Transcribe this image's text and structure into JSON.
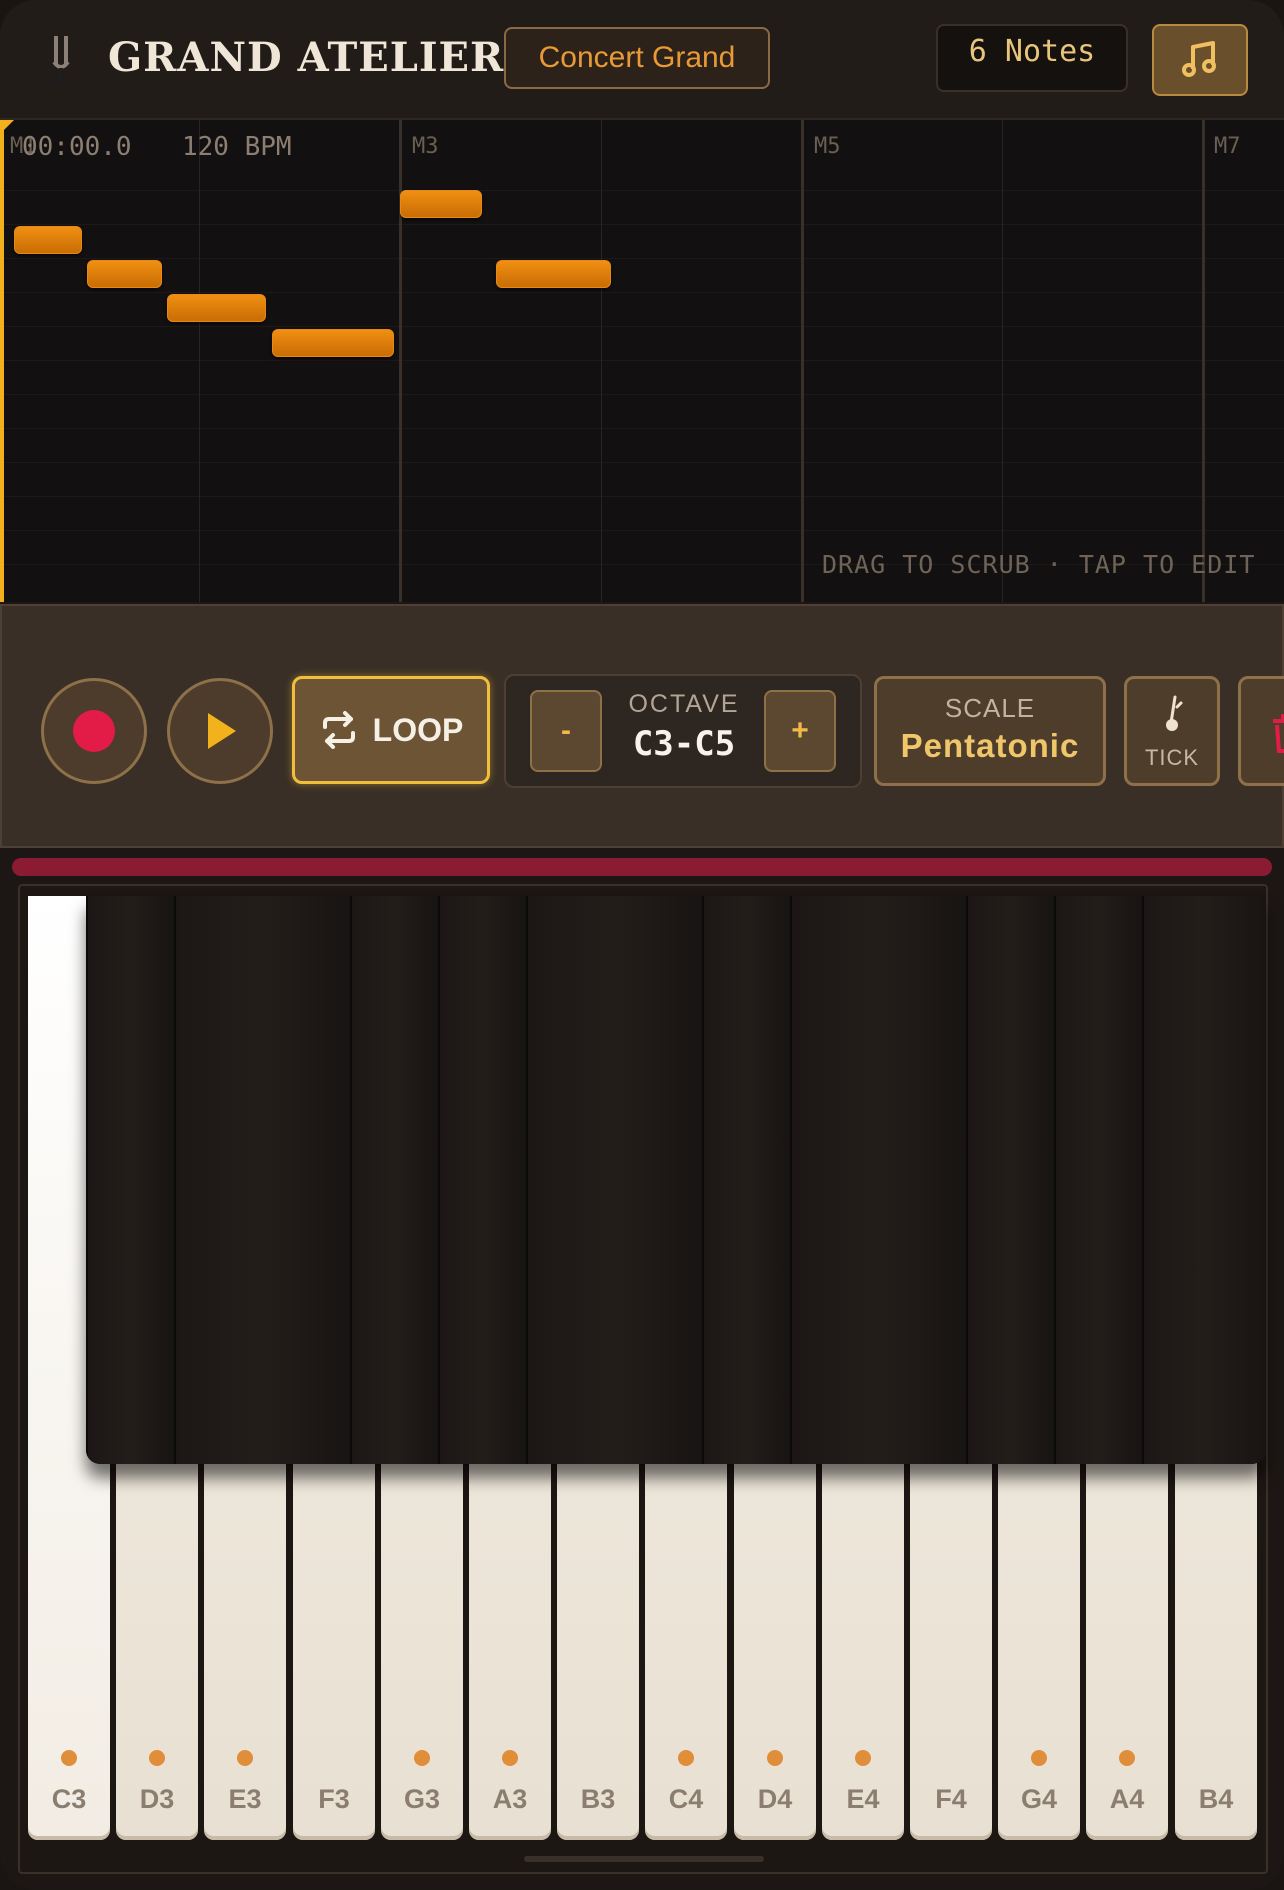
{
  "header": {
    "title": "GRAND ATELIER",
    "instrument": "Concert Grand",
    "notes_count": "6 Notes"
  },
  "timeline": {
    "time": "00:00.0",
    "bpm": "120 BPM",
    "measures": [
      "M1",
      "M3",
      "M5",
      "M7"
    ],
    "hint": "DRAG TO SCRUB · TAP TO EDIT",
    "playhead_color": "#f2b01c",
    "note_color": "#e8820c"
  },
  "controls": {
    "loop_label": "LOOP",
    "loop_active": true,
    "octave_title": "OCTAVE",
    "octave_range": "C3-C5",
    "octave_minus": "-",
    "octave_plus": "+",
    "scale_title": "SCALE",
    "scale_value": "Pentatonic",
    "tick_label": "TICK",
    "record_color": "#e31b47",
    "accent": "#f2bf3c"
  },
  "velocity": {
    "color": "#8b1a33"
  },
  "keyboard": {
    "white_keys": [
      {
        "label": "C3",
        "in_scale": true
      },
      {
        "label": "D3",
        "in_scale": true
      },
      {
        "label": "E3",
        "in_scale": true
      },
      {
        "label": "F3",
        "in_scale": false
      },
      {
        "label": "G3",
        "in_scale": true
      },
      {
        "label": "A3",
        "in_scale": true
      },
      {
        "label": "B3",
        "in_scale": false
      },
      {
        "label": "C4",
        "in_scale": true
      },
      {
        "label": "D4",
        "in_scale": true
      },
      {
        "label": "E4",
        "in_scale": true
      },
      {
        "label": "F4",
        "in_scale": false
      },
      {
        "label": "G4",
        "in_scale": true
      },
      {
        "label": "A4",
        "in_scale": true
      },
      {
        "label": "B4",
        "in_scale": false
      }
    ],
    "pressed_key": "C3"
  }
}
